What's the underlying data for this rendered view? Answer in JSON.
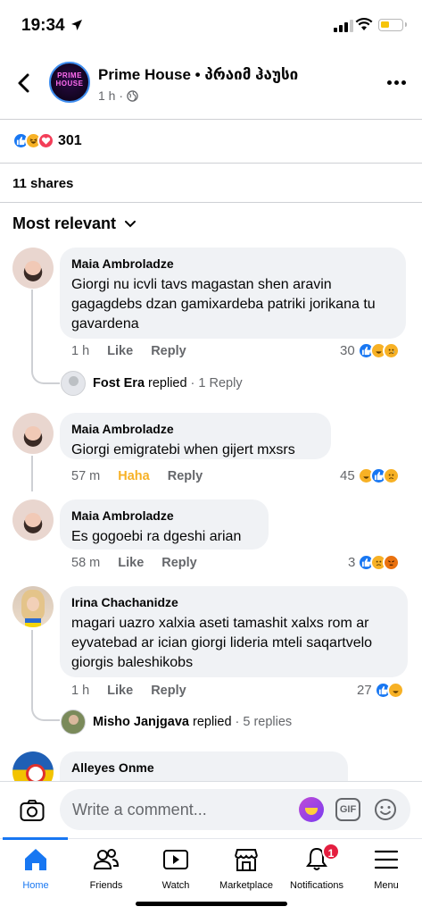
{
  "status_bar": {
    "time": "19:34"
  },
  "header": {
    "page_name": "Prime House • პრაიმ ჰაუსი",
    "logo_text_top": "PRIME",
    "logo_text_bottom": "HOUSE",
    "post_age": "1 h ·"
  },
  "post_stats": {
    "reaction_total": "301",
    "shares": "11 shares"
  },
  "sort": {
    "label": "Most relevant"
  },
  "comments": [
    {
      "author": "Maia Ambroladze",
      "text": "Giorgi nu icvli tavs magastan shen aravin gagagdebs dzan gamixardeba patriki  jorikana tu gavardena",
      "time": "1 h",
      "like_label": "Like",
      "reply_label": "Reply",
      "reaction_count": "30",
      "replies": {
        "name": "Fost Era",
        "verb": "replied",
        "count": "· 1 Reply"
      }
    },
    {
      "author": "Maia Ambroladze",
      "text": "Giorgi emigratebi when gijert mxsrs",
      "time": "57 m",
      "like_label": "Haha",
      "reply_label": "Reply",
      "reaction_count": "45"
    },
    {
      "author": "Maia Ambroladze",
      "text": "Es gogoebi ra dgeshi arian",
      "time": "58 m",
      "like_label": "Like",
      "reply_label": "Reply",
      "reaction_count": "3"
    },
    {
      "author": "Irina Chachanidze",
      "text": "magari uazro xalxia aseti tamashit xalxs rom ar eyvatebad ar ician giorgi lideria mteli saqartvelo giorgis baleshikobs",
      "time": "1 h",
      "like_label": "Like",
      "reply_label": "Reply",
      "reaction_count": "27",
      "replies": {
        "name": "Misho Janjgava",
        "verb": "replied",
        "count": "· 5 replies"
      }
    },
    {
      "author": "Alleyes Onme"
    }
  ],
  "composer": {
    "placeholder": "Write a comment...",
    "gif_label": "GIF"
  },
  "tabbar": {
    "home": "Home",
    "friends": "Friends",
    "watch": "Watch",
    "marketplace": "Marketplace",
    "notifications": "Notifications",
    "notifications_badge": "1",
    "menu": "Menu"
  },
  "colors": {
    "accent": "#1877f2",
    "bubble": "#f0f2f5",
    "haha": "#f7b125",
    "love": "#f33e58",
    "badge": "#e41e3f"
  }
}
